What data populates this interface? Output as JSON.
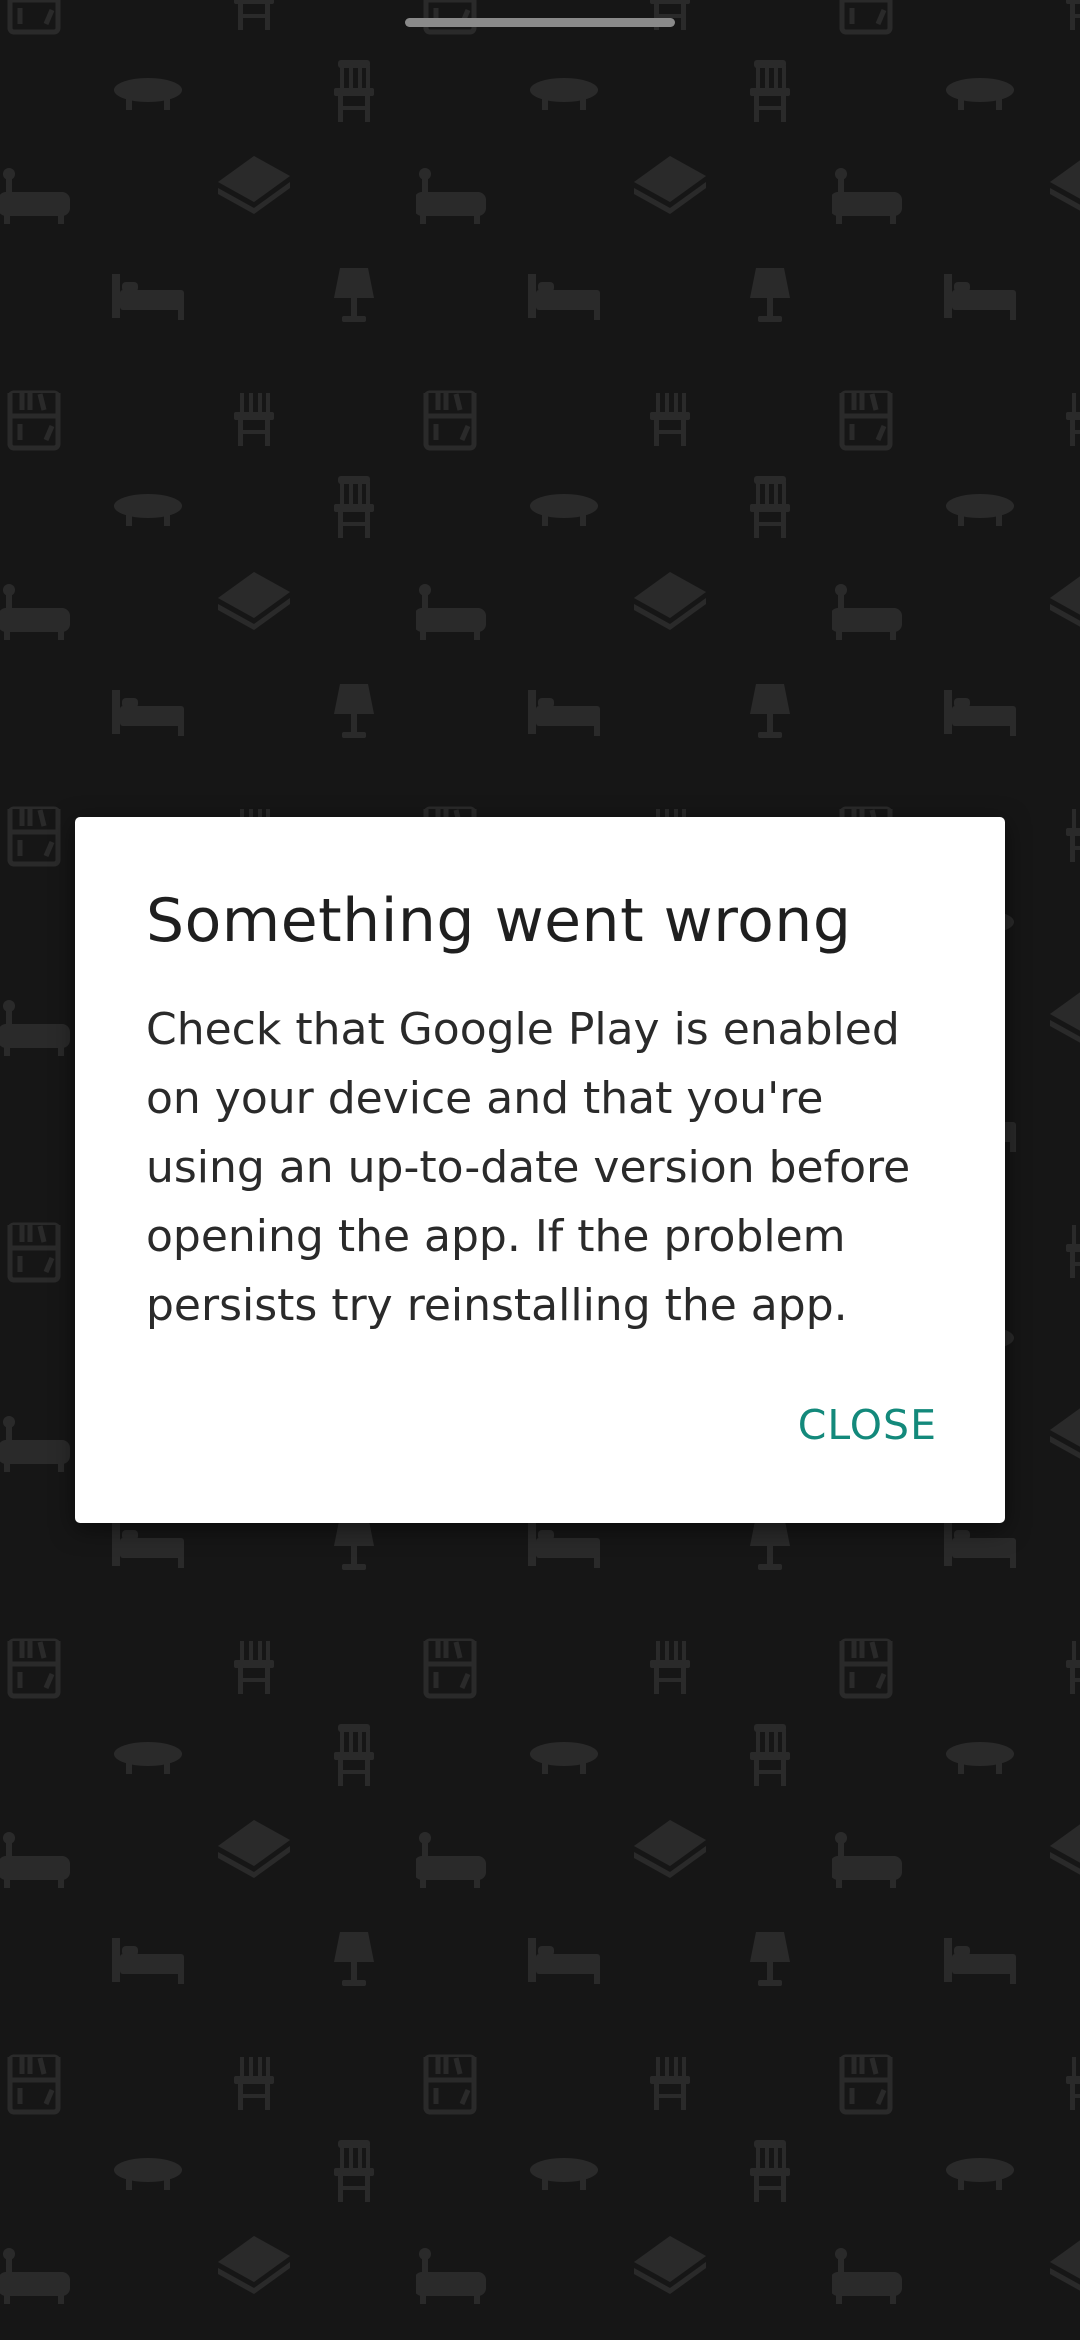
{
  "dialog": {
    "title": "Something went wrong",
    "message": "Check that Google Play is enabled on your device and that you're using an up-to-date version before opening the app. If the problem persists try reinstalling the app.",
    "close_label": "CLOSE"
  },
  "colors": {
    "background": "#161616",
    "pattern_icon": "#2a2a2a",
    "dialog_background": "#ffffff",
    "accent": "#13897b"
  },
  "background_icons": [
    "bookshelf-icon",
    "coffee-table-icon",
    "chair-icon",
    "bathtub-icon",
    "wood-planks-icon",
    "bed-icon",
    "lamp-icon",
    "potted-plant-icon"
  ]
}
